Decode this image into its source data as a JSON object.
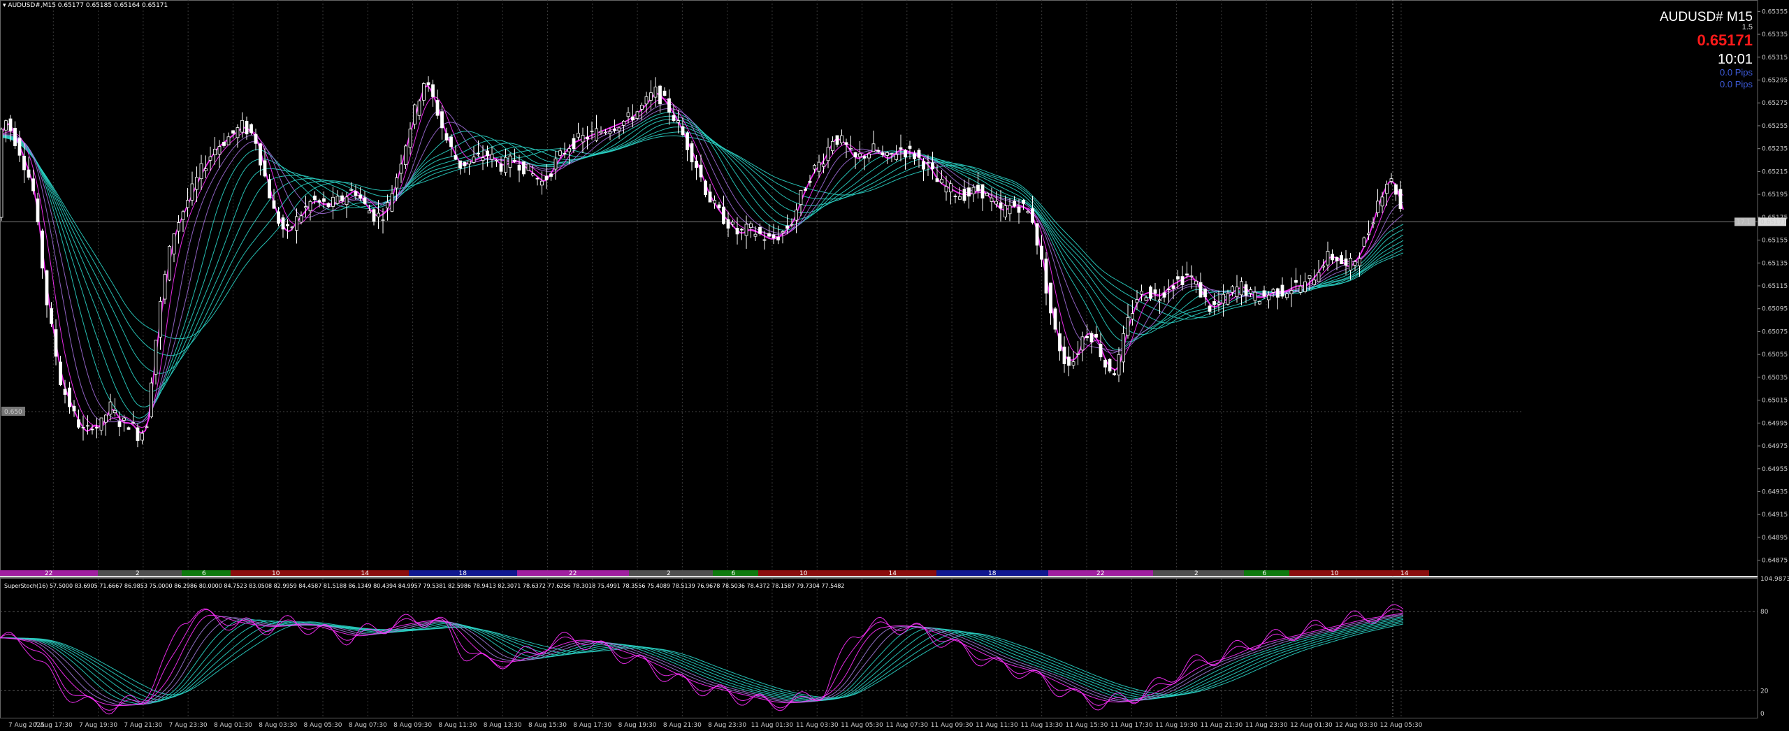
{
  "window": {
    "symbol_header": "AUDUSD#,M15  0.65177 0.65185 0.65164 0.65171",
    "subwindow_header": "SuperStoch(16) 57.5000 83.6905 71.6667 86.9853 75.0000 86.2986 80.0000 84.7523 83.0508 82.9959 84.4587 81.5188 86.1349 80.4394 84.9957 79.5381 82.5986 78.9413 82.3071 78.6372 77.6256 78.3018 75.4991 78.3556 75.4089 78.5139 76.9678 78.5036 78.4372 78.1587 79.7304 77.5482"
  },
  "info_panel": {
    "symbol": "AUDUSD# M15",
    "spread": "1.5",
    "price": "0.65171",
    "time": "10:01",
    "pips_1": "0.0 Pips",
    "pips_2": "0.0 Pips",
    "price_color": "#ff1a1a",
    "pips_color": "#3d5bd9"
  },
  "markers": {
    "current_price_label": "0.65171",
    "spread_tag": "17.1",
    "left_level_tag": "0.650"
  },
  "colors": {
    "background": "#000000",
    "bull": "#ffffff",
    "bull_volume": "#1e9e1e",
    "ribbon_fast": "#ff30ff",
    "ribbon_slow": "#2ad1c4",
    "grid": "#3a3a3a"
  },
  "chart_data": [
    {
      "type": "candlestick",
      "symbol": "AUDUSD#",
      "timeframe": "M15",
      "ylim": [
        0.64865,
        0.65365
      ],
      "y_ticks": [
        "0.65355",
        "0.65335",
        "0.65315",
        "0.65295",
        "0.65275",
        "0.65255",
        "0.65235",
        "0.65215",
        "0.65195",
        "0.65175",
        "0.65155",
        "0.65135",
        "0.65115",
        "0.65095",
        "0.65075",
        "0.65055",
        "0.65035",
        "0.65015",
        "0.64995",
        "0.64975",
        "0.64955",
        "0.64935",
        "0.64915",
        "0.64895",
        "0.64875"
      ],
      "x_labels": [
        "7 Aug 2025",
        "7 Aug 17:30",
        "7 Aug 19:30",
        "7 Aug 21:30",
        "7 Aug 23:30",
        "8 Aug 01:30",
        "8 Aug 03:30",
        "8 Aug 05:30",
        "8 Aug 07:30",
        "8 Aug 09:30",
        "8 Aug 11:30",
        "8 Aug 13:30",
        "8 Aug 15:30",
        "8 Aug 17:30",
        "8 Aug 19:30",
        "8 Aug 21:30",
        "8 Aug 23:30",
        "11 Aug 01:30",
        "11 Aug 03:30",
        "11 Aug 05:30",
        "11 Aug 07:30",
        "11 Aug 09:30",
        "11 Aug 11:30",
        "11 Aug 13:30",
        "11 Aug 15:30",
        "11 Aug 17:30",
        "11 Aug 19:30",
        "11 Aug 21:30",
        "11 Aug 23:30",
        "12 Aug 01:30",
        "12 Aug 03:30",
        "12 Aug 05:30"
      ],
      "price_path": [
        [
          0,
          0.65245
        ],
        [
          12,
          0.6526
        ],
        [
          30,
          0.65235
        ],
        [
          50,
          0.652
        ],
        [
          70,
          0.651
        ],
        [
          90,
          0.6503
        ],
        [
          110,
          0.65
        ],
        [
          125,
          0.64985
        ],
        [
          135,
          0.64995
        ],
        [
          145,
          0.6499
        ],
        [
          160,
          0.6501
        ],
        [
          175,
          0.64995
        ],
        [
          190,
          0.64995
        ],
        [
          200,
          0.64985
        ],
        [
          212,
          0.6499
        ],
        [
          222,
          0.6505
        ],
        [
          235,
          0.6511
        ],
        [
          250,
          0.6516
        ],
        [
          268,
          0.65185
        ],
        [
          290,
          0.65215
        ],
        [
          310,
          0.65235
        ],
        [
          330,
          0.65245
        ],
        [
          350,
          0.65255
        ],
        [
          368,
          0.65245
        ],
        [
          380,
          0.65215
        ],
        [
          395,
          0.6518
        ],
        [
          412,
          0.6516
        ],
        [
          430,
          0.65175
        ],
        [
          450,
          0.6519
        ],
        [
          470,
          0.65185
        ],
        [
          490,
          0.6519
        ],
        [
          510,
          0.652
        ],
        [
          525,
          0.65185
        ],
        [
          540,
          0.65175
        ],
        [
          555,
          0.6518
        ],
        [
          570,
          0.6521
        ],
        [
          590,
          0.65255
        ],
        [
          610,
          0.65295
        ],
        [
          625,
          0.65275
        ],
        [
          640,
          0.65245
        ],
        [
          660,
          0.6522
        ],
        [
          680,
          0.65225
        ],
        [
          700,
          0.6523
        ],
        [
          720,
          0.6522
        ],
        [
          740,
          0.65225
        ],
        [
          760,
          0.65215
        ],
        [
          780,
          0.65205
        ],
        [
          800,
          0.65225
        ],
        [
          820,
          0.6524
        ],
        [
          840,
          0.65245
        ],
        [
          860,
          0.6525
        ],
        [
          880,
          0.65255
        ],
        [
          900,
          0.6526
        ],
        [
          920,
          0.6527
        ],
        [
          940,
          0.65285
        ],
        [
          955,
          0.65275
        ],
        [
          970,
          0.6526
        ],
        [
          985,
          0.6524
        ],
        [
          1000,
          0.6522
        ],
        [
          1015,
          0.65195
        ],
        [
          1030,
          0.6518
        ],
        [
          1045,
          0.6517
        ],
        [
          1060,
          0.6516
        ],
        [
          1075,
          0.65165
        ],
        [
          1090,
          0.6516
        ],
        [
          1105,
          0.65155
        ],
        [
          1120,
          0.6516
        ],
        [
          1135,
          0.6517
        ],
        [
          1150,
          0.65195
        ],
        [
          1165,
          0.65215
        ],
        [
          1180,
          0.65225
        ],
        [
          1195,
          0.65245
        ],
        [
          1210,
          0.6524
        ],
        [
          1225,
          0.65225
        ],
        [
          1240,
          0.6523
        ],
        [
          1255,
          0.65235
        ],
        [
          1270,
          0.65225
        ],
        [
          1290,
          0.65235
        ],
        [
          1310,
          0.6523
        ],
        [
          1330,
          0.6522
        ],
        [
          1345,
          0.65205
        ],
        [
          1360,
          0.652
        ],
        [
          1375,
          0.65195
        ],
        [
          1390,
          0.65195
        ],
        [
          1405,
          0.652
        ],
        [
          1420,
          0.6519
        ],
        [
          1435,
          0.6518
        ],
        [
          1450,
          0.65185
        ],
        [
          1465,
          0.65185
        ],
        [
          1480,
          0.65175
        ],
        [
          1495,
          0.6513
        ],
        [
          1510,
          0.6508
        ],
        [
          1525,
          0.6505
        ],
        [
          1540,
          0.6505
        ],
        [
          1555,
          0.65075
        ],
        [
          1570,
          0.6507
        ],
        [
          1585,
          0.65045
        ],
        [
          1600,
          0.6504
        ],
        [
          1615,
          0.6508
        ],
        [
          1630,
          0.65105
        ],
        [
          1645,
          0.6511
        ],
        [
          1660,
          0.65105
        ],
        [
          1675,
          0.65115
        ],
        [
          1690,
          0.6512
        ],
        [
          1705,
          0.65125
        ],
        [
          1720,
          0.6511
        ],
        [
          1735,
          0.65095
        ],
        [
          1750,
          0.651
        ],
        [
          1765,
          0.6511
        ],
        [
          1780,
          0.65115
        ],
        [
          1795,
          0.65105
        ],
        [
          1810,
          0.65105
        ],
        [
          1825,
          0.6511
        ],
        [
          1840,
          0.6511
        ],
        [
          1855,
          0.65115
        ],
        [
          1870,
          0.65115
        ],
        [
          1885,
          0.65125
        ],
        [
          1900,
          0.6514
        ],
        [
          1915,
          0.6514
        ],
        [
          1930,
          0.6513
        ],
        [
          1945,
          0.6514
        ],
        [
          1960,
          0.6516
        ],
        [
          1975,
          0.6519
        ],
        [
          1990,
          0.6521
        ],
        [
          2000,
          0.652
        ],
        [
          2010,
          0.65175
        ]
      ],
      "current_price": 0.65171,
      "level_line": 0.65005
    },
    {
      "type": "line",
      "name": "SuperStoch(16)",
      "ylim": [
        0,
        104.9873
      ],
      "y_ticks": [
        "104.9873",
        "80",
        "20",
        "0"
      ],
      "levels": [
        80,
        20
      ],
      "series_path": [
        [
          0,
          60
        ],
        [
          40,
          55
        ],
        [
          80,
          25
        ],
        [
          120,
          10
        ],
        [
          160,
          8
        ],
        [
          200,
          12
        ],
        [
          240,
          45
        ],
        [
          260,
          75
        ],
        [
          280,
          80
        ],
        [
          300,
          75
        ],
        [
          340,
          70
        ],
        [
          380,
          68
        ],
        [
          420,
          72
        ],
        [
          460,
          65
        ],
        [
          500,
          60
        ],
        [
          540,
          68
        ],
        [
          580,
          72
        ],
        [
          620,
          75
        ],
        [
          640,
          65
        ],
        [
          660,
          50
        ],
        [
          700,
          40
        ],
        [
          740,
          45
        ],
        [
          780,
          55
        ],
        [
          820,
          60
        ],
        [
          860,
          52
        ],
        [
          900,
          45
        ],
        [
          940,
          35
        ],
        [
          980,
          25
        ],
        [
          1020,
          20
        ],
        [
          1060,
          15
        ],
        [
          1100,
          10
        ],
        [
          1140,
          12
        ],
        [
          1180,
          20
        ],
        [
          1200,
          40
        ],
        [
          1220,
          65
        ],
        [
          1260,
          70
        ],
        [
          1300,
          68
        ],
        [
          1340,
          60
        ],
        [
          1380,
          50
        ],
        [
          1420,
          40
        ],
        [
          1460,
          35
        ],
        [
          1500,
          25
        ],
        [
          1540,
          15
        ],
        [
          1580,
          10
        ],
        [
          1620,
          15
        ],
        [
          1660,
          25
        ],
        [
          1700,
          40
        ],
        [
          1740,
          45
        ],
        [
          1780,
          55
        ],
        [
          1820,
          60
        ],
        [
          1860,
          65
        ],
        [
          1900,
          70
        ],
        [
          1940,
          75
        ],
        [
          1980,
          78
        ],
        [
          2000,
          80
        ],
        [
          2010,
          83
        ]
      ]
    }
  ],
  "session_bars": [
    {
      "label": "22",
      "color": "#a020a0",
      "x0": 0,
      "x1": 140
    },
    {
      "label": "2",
      "color": "#505050",
      "x0": 140,
      "x1": 260
    },
    {
      "label": "6",
      "color": "#0f7a0f",
      "x0": 260,
      "x1": 330
    },
    {
      "label": "10",
      "color": "#8b0e0e",
      "x0": 330,
      "x1": 460
    },
    {
      "label": "14",
      "color": "#8b0e0e",
      "x0": 460,
      "x1": 585
    },
    {
      "label": "18",
      "color": "#101890",
      "x0": 585,
      "x1": 740
    },
    {
      "label": "22",
      "color": "#a020a0",
      "x0": 740,
      "x1": 900
    },
    {
      "label": "2",
      "color": "#505050",
      "x0": 900,
      "x1": 1020
    },
    {
      "label": "6",
      "color": "#0f7a0f",
      "x0": 1020,
      "x1": 1085
    },
    {
      "label": "10",
      "color": "#8b0e0e",
      "x0": 1085,
      "x1": 1215
    },
    {
      "label": "14",
      "color": "#8b0e0e",
      "x0": 1215,
      "x1": 1340
    },
    {
      "label": "18",
      "color": "#101890",
      "x0": 1340,
      "x1": 1500
    },
    {
      "label": "22",
      "color": "#a020a0",
      "x0": 1500,
      "x1": 1650
    },
    {
      "label": "2",
      "color": "#505050",
      "x0": 1650,
      "x1": 1780
    },
    {
      "label": "6",
      "color": "#0f7a0f",
      "x0": 1780,
      "x1": 1845
    },
    {
      "label": "10",
      "color": "#8b0e0e",
      "x0": 1845,
      "x1": 1975
    },
    {
      "label": "14",
      "color": "#8b0e0e",
      "x0": 1975,
      "x1": 2045
    }
  ]
}
